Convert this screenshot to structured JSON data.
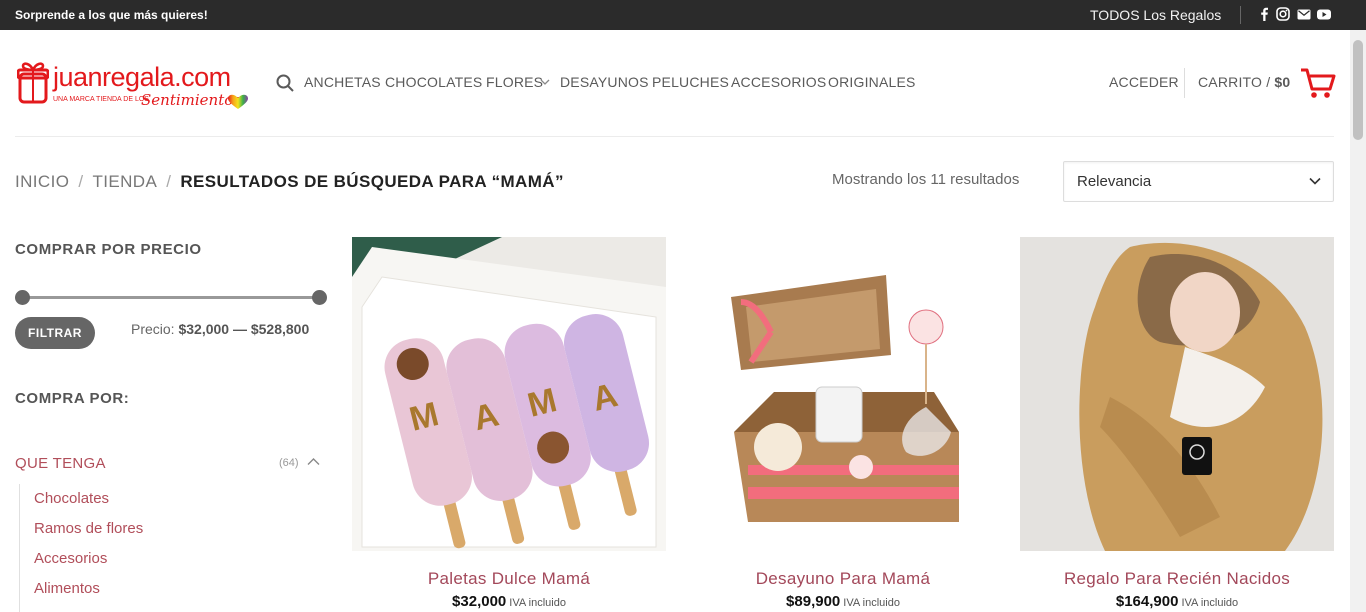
{
  "topbar": {
    "promo": "Sorprende a los que más quieres!",
    "all_gifts": "TODOS Los Regalos",
    "social_icons": [
      "facebook-icon",
      "instagram-icon",
      "email-icon",
      "youtube-icon"
    ]
  },
  "logo": {
    "name": "juanregala.com",
    "tagline": "UNA MARCA TIENDA DE LOS",
    "script": "Sentimientos"
  },
  "nav": {
    "items": [
      "ANCHETAS",
      "CHOCOLATES",
      "FLORES",
      "DESAYUNOS",
      "PELUCHES",
      "ACCESORIOS",
      "ORIGINALES"
    ]
  },
  "account": {
    "login": "ACCEDER",
    "cart_label": "CARRITO /",
    "cart_total": "$0"
  },
  "breadcrumb": {
    "home": "INICIO",
    "shop": "TIENDA",
    "divider": "/",
    "current": "RESULTADOS DE BÚSQUEDA PARA “MAMÁ”"
  },
  "results": {
    "count_text": "Mostrando los 11 resultados",
    "sort_value": "Relevancia"
  },
  "sidebar": {
    "price_title": "COMPRAR POR PRECIO",
    "filter_button": "FILTRAR",
    "price_label": "Precio:",
    "price_range": "$32,000 — $528,800",
    "buy_by_title": "COMPRA POR:",
    "category": {
      "label": "QUE TENGA",
      "count": "(64)",
      "children": [
        "Chocolates",
        "Ramos de flores",
        "Accesorios",
        "Alimentos"
      ]
    }
  },
  "products": [
    {
      "name": "Paletas Dulce Mamá",
      "price": "$32,000",
      "tax": "IVA incluido"
    },
    {
      "name": "Desayuno Para Mamá",
      "price": "$89,900",
      "tax": "IVA incluido"
    },
    {
      "name": "Regalo Para Recién Nacidos",
      "price": "$164,900",
      "tax": "IVA incluido"
    }
  ],
  "colors": {
    "brand_red": "#e3191c",
    "link_rose": "#b14e5a",
    "topbar_bg": "#2b2b2b"
  }
}
